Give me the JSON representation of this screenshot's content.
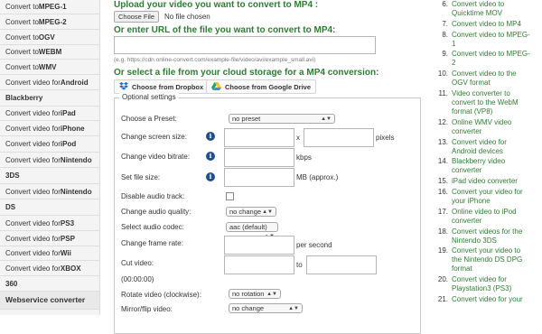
{
  "sidebar": {
    "items": [
      {
        "label": "Convert to ",
        "bold": "MPEG-1"
      },
      {
        "label": "Convert to ",
        "bold": "MPEG-2"
      },
      {
        "label": "Convert to ",
        "bold": "OGV"
      },
      {
        "label": "Convert to ",
        "bold": "WEBM"
      },
      {
        "label": "Convert to ",
        "bold": "WMV"
      },
      {
        "label": "Convert video for ",
        "bold": "Android"
      },
      {
        "label": "",
        "bold": "Blackberry"
      },
      {
        "label": "Convert video for ",
        "bold": "iPad"
      },
      {
        "label": "Convert video for ",
        "bold": "iPhone"
      },
      {
        "label": "Convert video for ",
        "bold": "iPod"
      },
      {
        "label": "Convert video for ",
        "bold": "Nintendo"
      },
      {
        "label": "",
        "bold": "3DS"
      },
      {
        "label": "Convert video for ",
        "bold": "Nintendo"
      },
      {
        "label": "",
        "bold": "DS"
      },
      {
        "label": "Convert video for ",
        "bold": "PS3"
      },
      {
        "label": "Convert video for ",
        "bold": "PSP"
      },
      {
        "label": "Convert video for ",
        "bold": "Wii"
      },
      {
        "label": "Convert video for ",
        "bold": "XBOX"
      },
      {
        "label": "",
        "bold": "360"
      }
    ],
    "active": "Webservice converter"
  },
  "main": {
    "upload_heading": "Upload your video you want to convert to MP4 :",
    "choose_file": "Choose File",
    "no_file": "No file chosen",
    "url_heading": "Or enter URL of the file you want to convert to MP4:",
    "url_hint": "(e.g. https://cdn.online-convert.com/example-file/video/avi/example_small.avi)",
    "cloud_heading": "Or select a file from your cloud storage for a MP4 conversion:",
    "dropbox": "Choose from Dropbox",
    "gdrive": "Choose from Google Drive",
    "optional": "Optional settings",
    "preset_label": "Choose a Preset:",
    "preset_value": "no preset",
    "screen_size_label": "Change screen size:",
    "x_sep": "x",
    "pixels": "pixels",
    "bitrate_label": "Change video bitrate:",
    "kbps": "kbps",
    "file_size_label": "Set file size:",
    "mb_approx": "MB (approx.)",
    "disable_audio_label": "Disable audio track:",
    "audio_quality_label": "Change audio quality:",
    "audio_quality_value": "no change",
    "audio_codec_label": "Select audio codec:",
    "audio_codec_value": "aac (default)",
    "frame_rate_label": "Change frame rate:",
    "per_second": "per second",
    "cut_label": "Cut video:",
    "to": "to",
    "cut_time": "(00:00:00)",
    "rotate_label": "Rotate video (clockwise):",
    "rotate_value": "no rotation",
    "mirror_label": "Mirror/flip video:",
    "mirror_value": "no change",
    "info_glyph": "i"
  },
  "right_list": [
    {
      "n": "6.",
      "lines": [
        "Convert video to",
        "Quicktime MOV"
      ]
    },
    {
      "n": "7.",
      "lines": [
        "Convert video to MP4"
      ]
    },
    {
      "n": "8.",
      "lines": [
        "Convert video to MPEG-",
        "1"
      ]
    },
    {
      "n": "9.",
      "lines": [
        "Convert video to MPEG-",
        "2"
      ]
    },
    {
      "n": "10.",
      "lines": [
        "Convert video to the",
        "OGV format"
      ]
    },
    {
      "n": "11.",
      "lines": [
        "Video converter to",
        "convert to the WebM",
        "format (VP8)"
      ]
    },
    {
      "n": "12.",
      "lines": [
        "Online WMV video",
        "converter"
      ]
    },
    {
      "n": "13.",
      "lines": [
        "Convert video for",
        "Android devices"
      ]
    },
    {
      "n": "14.",
      "lines": [
        "Blackberry video",
        "converter"
      ]
    },
    {
      "n": "15.",
      "lines": [
        "iPad video converter"
      ]
    },
    {
      "n": "16.",
      "lines": [
        "Convert your video for",
        "your iPhone"
      ]
    },
    {
      "n": "17.",
      "lines": [
        "Online video to iPod",
        "converter"
      ]
    },
    {
      "n": "18.",
      "lines": [
        "Convert videos for the",
        "Nintendo 3DS"
      ]
    },
    {
      "n": "19.",
      "lines": [
        "Convert your video to",
        "the Nintendo DS DPG",
        "format"
      ]
    },
    {
      "n": "20.",
      "lines": [
        "Convert video for",
        "Playstation3 (PS3)"
      ]
    },
    {
      "n": "21.",
      "lines": [
        "Convert video for your"
      ]
    }
  ],
  "colors": {
    "link_green": "#2e7d32",
    "info_blue": "#1f4f8a"
  }
}
